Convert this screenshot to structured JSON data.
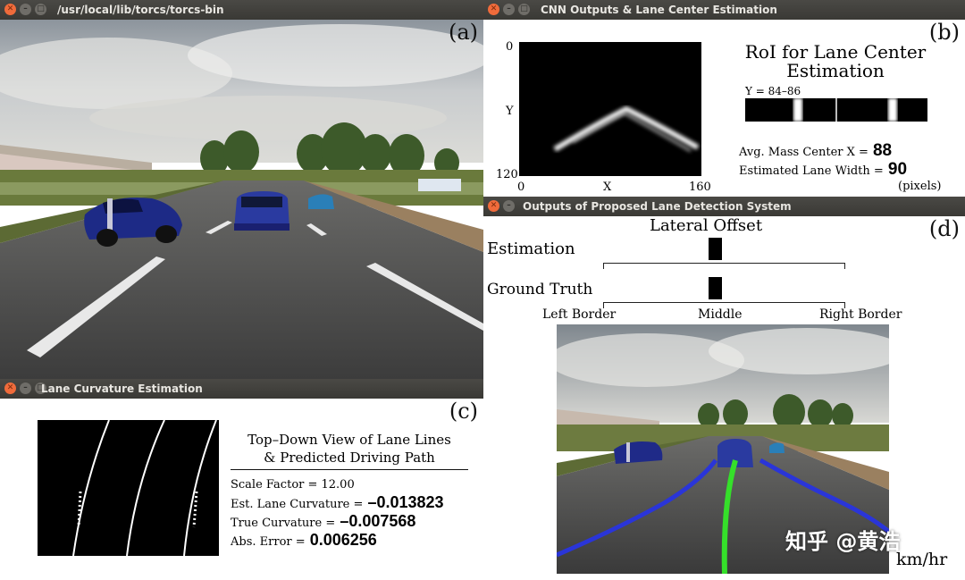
{
  "win_a": {
    "title": "/usr/local/lib/torcs/torcs-bin",
    "letter": "(a)"
  },
  "win_b": {
    "title": "CNN Outputs & Lane Center Estimation",
    "letter": "(b)",
    "y_axis": {
      "label": "Y",
      "top": "0",
      "bottom": "120"
    },
    "x_axis": {
      "left": "0",
      "label": "X",
      "right": "160"
    },
    "roi_title_1": "RoI for Lane Center",
    "roi_title_2": "Estimation",
    "roi_range": "Y = 84–86",
    "mass_label": "Avg. Mass Center X =",
    "mass_value": "88",
    "width_label": "Estimated Lane Width =",
    "width_value": "90",
    "unit": "(pixels)"
  },
  "win_c": {
    "title": "Lane Curvature Estimation",
    "letter": "(c)",
    "heading_1": "Top–Down View of Lane Lines",
    "heading_2": "& Predicted Driving Path",
    "scale_label": "Scale Factor = 12.00",
    "est_label": "Est. Lane Curvature =",
    "est_value": "–0.013823",
    "true_label": "True Curvature =",
    "true_value": "–0.007568",
    "abs_label": "Abs. Error =",
    "abs_value": "0.006256"
  },
  "win_d": {
    "title": "Outputs of Proposed Lane Detection System",
    "letter": "(d)",
    "offset_title": "Lateral Offset",
    "estimation_label": "Estimation",
    "ground_truth_label": "Ground Truth",
    "left_label": "Left Border",
    "middle_label": "Middle",
    "right_label": "Right Border",
    "speed_unit": "km/hr",
    "estimation_offset": 0.0,
    "ground_truth_offset": 0.0
  },
  "watermark": "知乎 @黄浩"
}
